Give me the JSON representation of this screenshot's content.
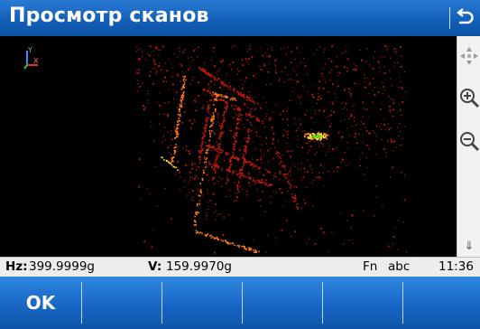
{
  "window": {
    "title": "Просмотр сканов",
    "back_icon": "return-arrow-icon"
  },
  "viewport": {
    "axis_icon": "xyz-axis-icon",
    "axis_labels": {
      "x": "X",
      "y": "Y"
    }
  },
  "sidebar": {
    "icons": [
      "pan-arrows-icon",
      "zoom-in-icon",
      "zoom-out-icon",
      "double-chevron-down-icon"
    ]
  },
  "status": {
    "hz_label": "Hz:",
    "hz_value": "399.9999g",
    "v_label": "V:",
    "v_value": "159.9970g",
    "fn": "Fn",
    "input_mode": "abc",
    "time": "11:36"
  },
  "softkeys": [
    "OK",
    "",
    "",
    "",
    "",
    ""
  ],
  "colors": {
    "title_blue": "#135fb8",
    "softkey_blue": "#1564c0",
    "point_red": "#c0190c",
    "point_orange": "#ff7a1a",
    "point_yellow": "#ffe23a",
    "point_green": "#6ad21e"
  }
}
